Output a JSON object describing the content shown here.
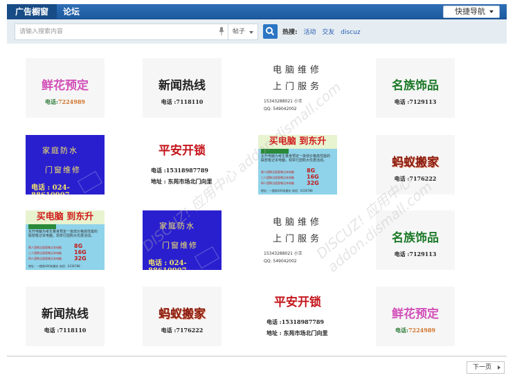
{
  "nav": {
    "tabs": [
      {
        "label": "广告橱窗"
      },
      {
        "label": "论坛"
      }
    ],
    "quick_nav_label": "快捷导航"
  },
  "search": {
    "placeholder": "请输入搜索内容",
    "scope": "帖子",
    "hot_label": "热搜:",
    "hot_terms": [
      "活动",
      "交友",
      "discuz"
    ]
  },
  "ads": {
    "flower": {
      "title": "鲜花预定",
      "phone_label": "电话:",
      "phone": "7224989"
    },
    "news": {
      "title": "新闻热线",
      "phone": "电话 :7118110"
    },
    "jewel": {
      "title": "名族饰品",
      "phone": "电话 :7129113"
    },
    "move": {
      "title": "蚂蚁搬家",
      "phone": "电话 :7176222"
    },
    "lock": {
      "title": "平安开锁",
      "tel": "电话 :15318987789",
      "addr": "地址 : 东苑市场北门向里"
    },
    "repair": {
      "line1": "电脑维修",
      "line2": "上门服务",
      "tel": "15343288021  小王",
      "qq": "QQ: 549042002"
    },
    "water": {
      "line1": "家庭防水",
      "line2": "门窗维修",
      "tel": "电话 : 024-88610907"
    },
    "pc": {
      "headline": "买电脑 到东升",
      "body": "东升电脑为考生量身预定一批低价格高性能的联想笔记本电脑，现举行团购大优惠活动。",
      "rows": [
        "两人团购当里面笔记本电脑",
        "三人团购当里面笔记本电脑",
        "四人团购当里面笔记本电脑"
      ],
      "sizes": [
        "8G",
        "16G",
        "32G"
      ],
      "footer": "地址：一楼南300米路东  电话：6236788"
    }
  },
  "pager": {
    "next_label": "下一页"
  },
  "watermark": "DISCUZ! 应用中心 addon.dismall.com"
}
